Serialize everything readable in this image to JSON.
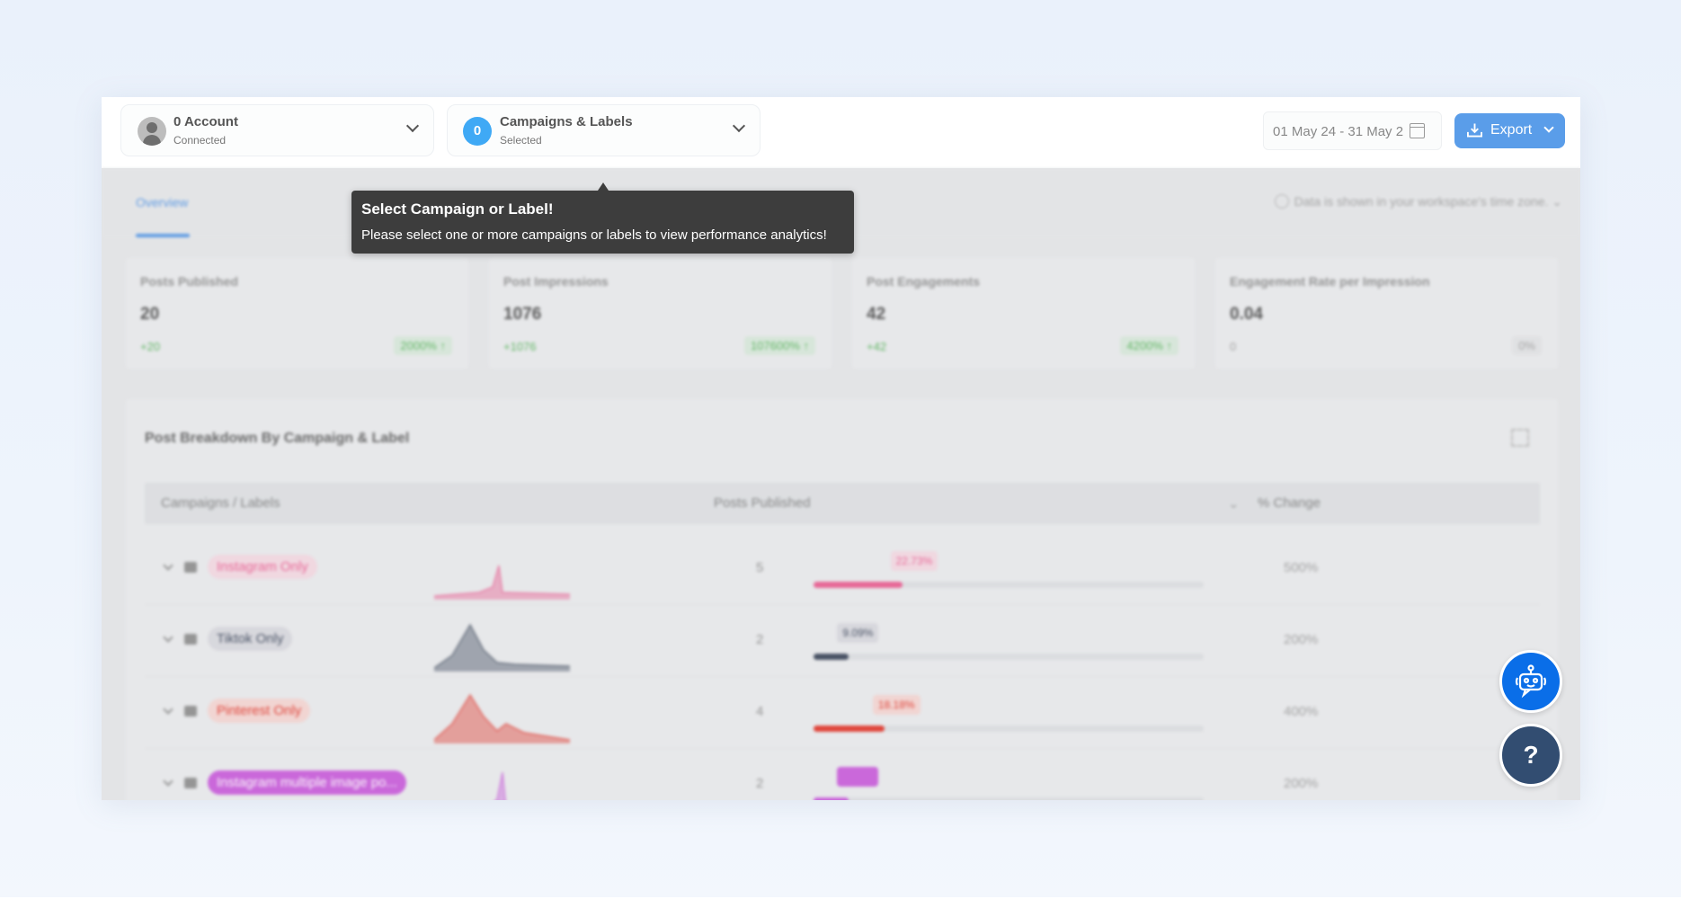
{
  "header": {
    "account": {
      "title": "0 Account",
      "subtitle": "Connected"
    },
    "campaigns": {
      "count": "0",
      "title": "Campaigns & Labels",
      "subtitle": "Selected"
    },
    "date_range": "01 May 24 - 31 May 2",
    "export_label": "Export"
  },
  "tooltip": {
    "title": "Select Campaign or Label!",
    "body": "Please select one or more campaigns or labels to view performance analytics!"
  },
  "tabs": [
    {
      "label": "Overview",
      "active": true
    }
  ],
  "timezone_note": "Data is shown in your workspace's time zone.",
  "kpis": [
    {
      "label": "Posts Published",
      "value": "20",
      "delta": "+20",
      "pct": "2000% ↑"
    },
    {
      "label": "Post Impressions",
      "value": "1076",
      "delta": "+1076",
      "pct": "107600% ↑"
    },
    {
      "label": "Post Engagements",
      "value": "42",
      "delta": "+42",
      "pct": "4200% ↑"
    },
    {
      "label": "Engagement Rate per Impression",
      "value": "0.04",
      "delta": "0",
      "pct": "0%"
    }
  ],
  "breakdown": {
    "title": "Post Breakdown By Campaign & Label",
    "columns": [
      "Campaigns / Labels",
      "Posts Published",
      "% Change"
    ],
    "rows": [
      {
        "label": "Instagram Only",
        "posts": "5",
        "share": "22.73%",
        "share_value": 22.73,
        "change": "500%",
        "color": "#e8538a",
        "pill_bg": "#f3d6e0"
      },
      {
        "label": "Tiktok Only",
        "posts": "2",
        "share": "9.09%",
        "share_value": 9.09,
        "change": "200%",
        "color": "#2f3a4f",
        "pill_bg": "#d6d6dc"
      },
      {
        "label": "Pinterest Only",
        "posts": "4",
        "share": "18.18%",
        "share_value": 18.18,
        "change": "400%",
        "color": "#e02a1e",
        "pill_bg": "#f4d3cf"
      },
      {
        "label": "Instagram multiple image po...",
        "posts": "2",
        "share": "9.09%",
        "share_value": 9.09,
        "change": "200%",
        "color": "#c653d9",
        "pill_bg": "#c653d9"
      }
    ]
  },
  "fab": {
    "help_label": "?"
  }
}
